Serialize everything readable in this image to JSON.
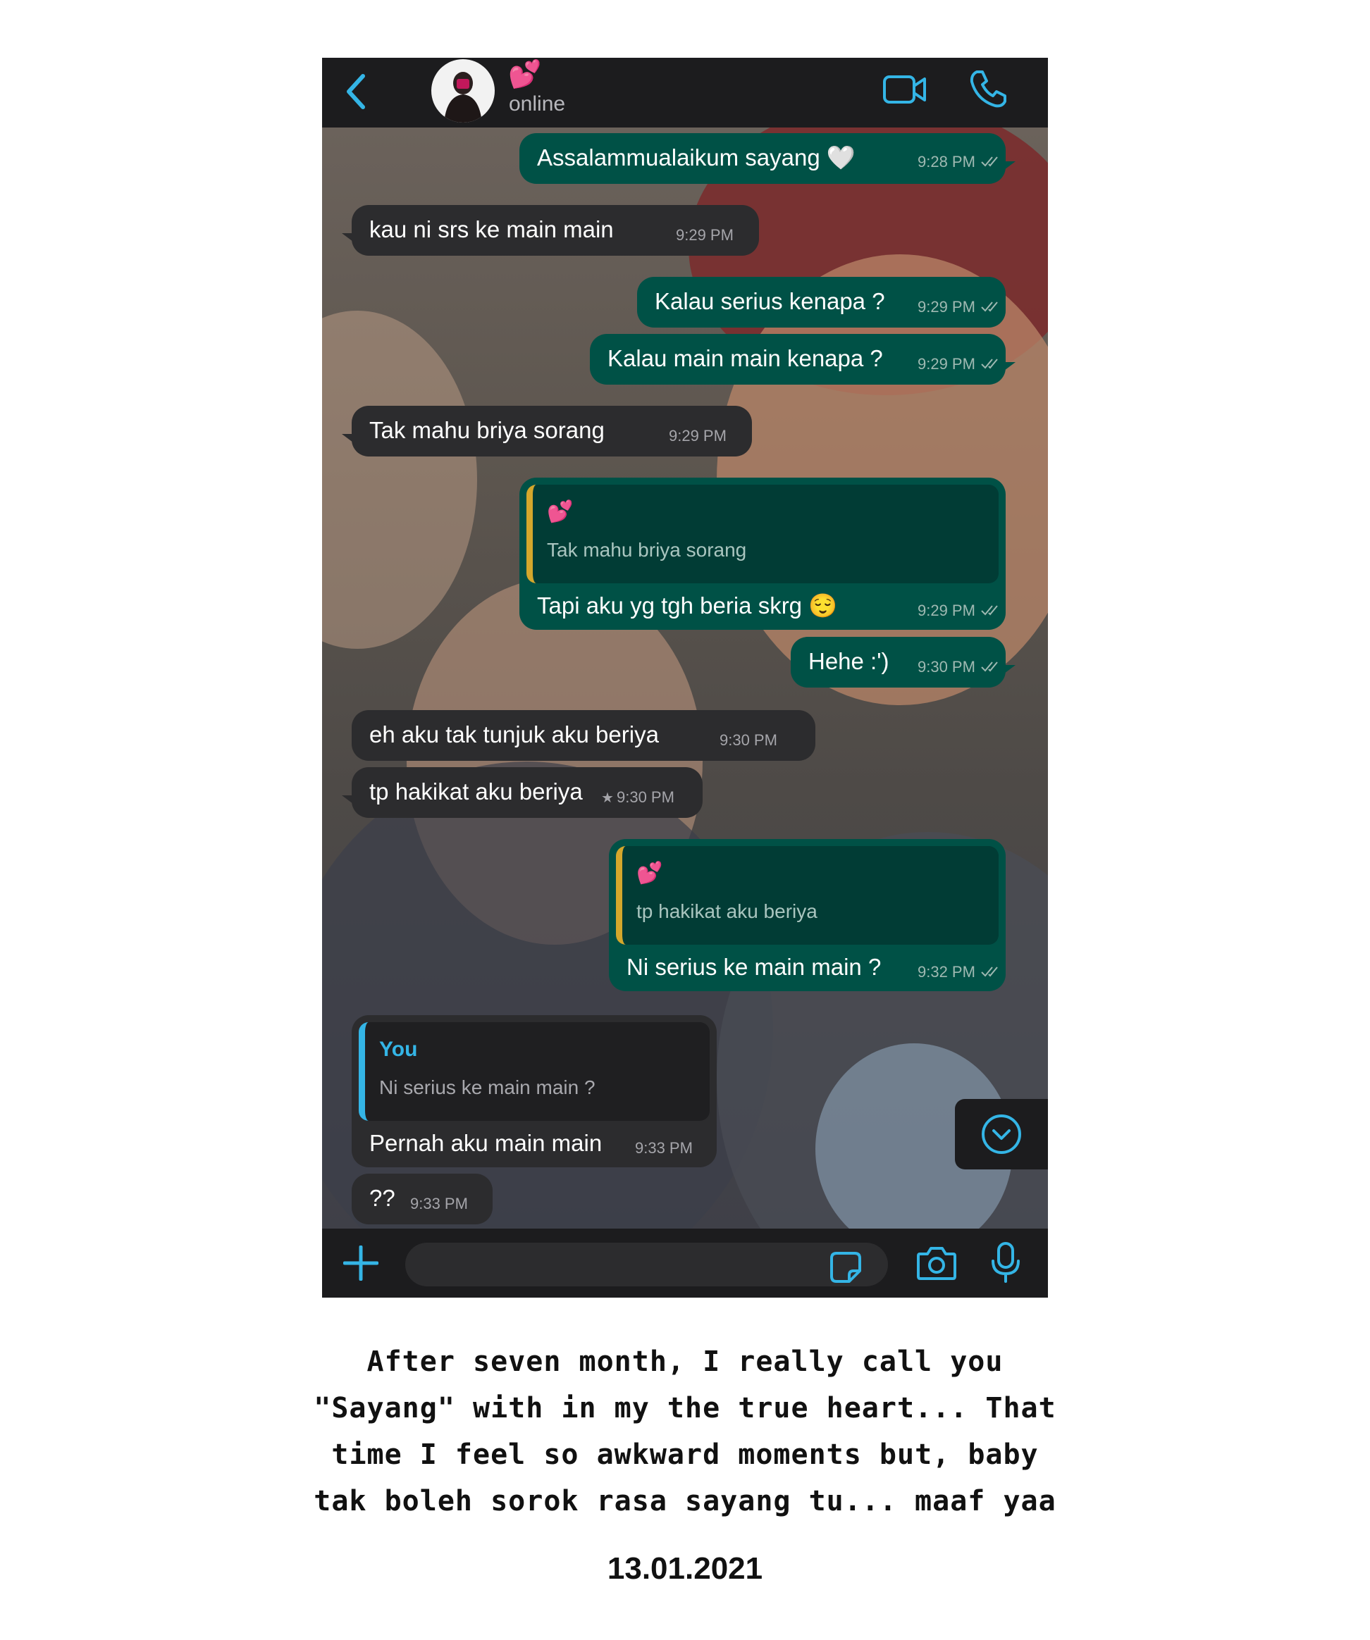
{
  "header": {
    "contact_name": "💕",
    "status": "online"
  },
  "messages": [
    {
      "id": "m1",
      "direction": "outgoing",
      "text": "Assalammualaikum sayang 🤍",
      "time": "9:28 PM",
      "read": true
    },
    {
      "id": "m2",
      "direction": "incoming",
      "text": "kau ni srs ke main main",
      "time": "9:29 PM"
    },
    {
      "id": "m3",
      "direction": "outgoing",
      "text": "Kalau serius kenapa ?",
      "time": "9:29 PM",
      "read": true
    },
    {
      "id": "m4",
      "direction": "outgoing",
      "text": "Kalau main main kenapa ?",
      "time": "9:29 PM",
      "read": true
    },
    {
      "id": "m5",
      "direction": "incoming",
      "text": "Tak mahu briya sorang",
      "time": "9:29 PM"
    },
    {
      "id": "m6",
      "direction": "outgoing",
      "quote_author": "💕",
      "quote_text": "Tak mahu briya sorang",
      "text": "Tapi aku yg tgh beria skrg 😌",
      "time": "9:29 PM",
      "read": true
    },
    {
      "id": "m7",
      "direction": "outgoing",
      "text": "Hehe :')",
      "time": "9:30 PM",
      "read": true
    },
    {
      "id": "m8",
      "direction": "incoming",
      "text": "eh aku tak tunjuk aku beriya",
      "time": "9:30 PM"
    },
    {
      "id": "m9",
      "direction": "incoming",
      "text": "tp hakikat aku beriya",
      "time": "9:30 PM",
      "starred": true
    },
    {
      "id": "m10",
      "direction": "outgoing",
      "quote_author": "💕",
      "quote_text": "tp hakikat aku beriya",
      "text": "Ni serius ke main main ?",
      "time": "9:32 PM",
      "read": true
    },
    {
      "id": "m11",
      "direction": "incoming",
      "quote_author": "You",
      "quote_text": "Ni serius ke main main ?",
      "text": "Pernah aku main main",
      "time": "9:33 PM"
    },
    {
      "id": "m12",
      "direction": "incoming",
      "text": "??",
      "time": "9:33 PM"
    }
  ],
  "icons": {
    "back": "chevron-left-icon",
    "video": "video-camera-icon",
    "call": "phone-icon",
    "scroll": "chevron-down-circle-icon",
    "attach": "plus-icon",
    "sticker": "sticker-icon",
    "camera": "camera-icon",
    "mic": "microphone-icon",
    "read": "double-check-icon",
    "star": "star-icon"
  },
  "colors": {
    "outgoing_bubble": "#005146",
    "incoming_bubble": "#2c2c2e",
    "accent_blue": "#34b5e6",
    "header_bg": "#1c1c1e",
    "quote_bar_outgoing": "#d4a72c",
    "quote_bar_incoming": "#34b5e6"
  },
  "caption": {
    "line1": "After seven month, I really call you",
    "line2": "\"Sayang\" with in my the true heart... That",
    "line3": "time I feel so awkward moments but, baby",
    "line4": "tak boleh sorok rasa sayang tu... maaf yaa",
    "date": "13.01.2021"
  }
}
